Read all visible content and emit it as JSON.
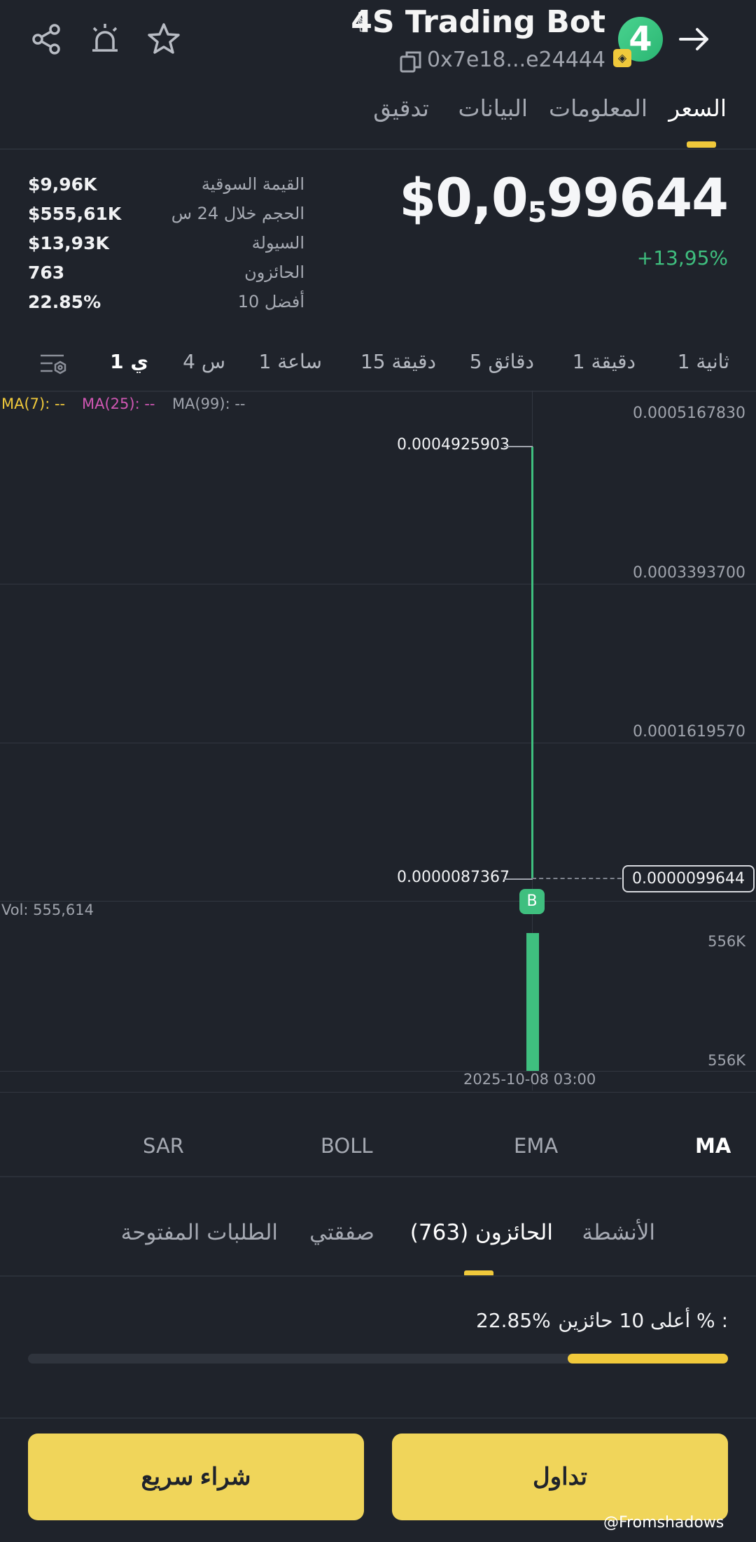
{
  "header": {
    "title": "4S Trading Bot",
    "address": "0x7e18...e24444",
    "logo_text": "4",
    "icons": [
      "share-icon",
      "alert-icon",
      "star-icon",
      "copy-icon",
      "arrow-right-icon"
    ]
  },
  "tabs": [
    {
      "label": "السعر",
      "active": true
    },
    {
      "label": "المعلومات",
      "active": false
    },
    {
      "label": "البيانات",
      "active": false
    },
    {
      "label": "تدقيق",
      "active": false
    }
  ],
  "price": {
    "main": "$0,0",
    "sub": "5",
    "tail": "99644",
    "change": "+13,95%"
  },
  "stats": [
    {
      "label": "القيمة السوقية",
      "value": "$9,96K"
    },
    {
      "label": "الحجم خلال 24 س",
      "value": "$555,61K"
    },
    {
      "label": "السيولة",
      "value": "$13,93K"
    },
    {
      "label": "الحائزون",
      "value": "763"
    },
    {
      "label": "أفضل 10",
      "value": "22.85%"
    }
  ],
  "intervals": [
    {
      "label": "1 ثانية",
      "active": false
    },
    {
      "label": "1 دقيقة",
      "active": false
    },
    {
      "label": "5 دقائق",
      "active": false
    },
    {
      "label": "15 دقيقة",
      "active": false
    },
    {
      "label": "1 ساعة",
      "active": false
    },
    {
      "label": "4 س",
      "active": false
    },
    {
      "label": "1 ي",
      "active": true
    }
  ],
  "chart": {
    "ma7": "MA(7): --",
    "ma25": "MA(25): --",
    "ma99": "MA(99): --",
    "price_ticks": [
      "0.0005167830",
      "0.0003393700",
      "0.0001619570"
    ],
    "high_label": "0.0004925903",
    "low_label": "0.0000087367",
    "current_price": "0.0000099644",
    "buy_marker": "B",
    "volume_label": "Vol: 555,614",
    "volume_ticks": [
      "556K",
      "556K"
    ],
    "date_label": "2025-10-08 03:00",
    "colors": {
      "up": "#3fbf7f",
      "ma7": "#f0c93b",
      "ma25": "#d057b3",
      "ma99": "#a0a4ad"
    }
  },
  "chart_data": {
    "type": "candlestick",
    "x": [
      "2025-10-08 03:00"
    ],
    "high": [
      0.0004925903
    ],
    "low": [
      8.7367e-06
    ],
    "close": [
      9.9644e-06
    ],
    "volume": [
      555614
    ],
    "y_ticks": [
      0.000516783,
      0.00033937,
      0.000161957
    ]
  },
  "indicators": [
    {
      "label": "MA",
      "active": true
    },
    {
      "label": "EMA",
      "active": false
    },
    {
      "label": "BOLL",
      "active": false
    },
    {
      "label": "SAR",
      "active": false
    }
  ],
  "bottom_tabs": [
    {
      "label": "الأنشطة",
      "active": false
    },
    {
      "label": "الحائزون (763)",
      "active": true
    },
    {
      "label": "صفقتي",
      "active": false
    },
    {
      "label": "الطلبات المفتوحة",
      "active": false
    }
  ],
  "top_holders": {
    "label": "أعلى 10 حائزين %",
    "colon": ":",
    "value": "22.85%",
    "fraction": 0.2285
  },
  "actions": {
    "trade": "تداول",
    "quick_buy": "شراء سريع"
  },
  "watermark": "@Fromshadows"
}
